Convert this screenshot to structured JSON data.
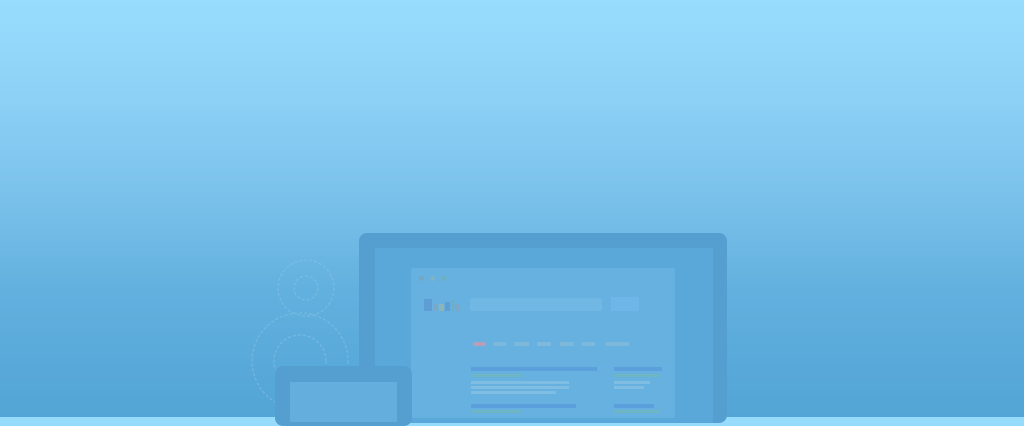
{
  "hero": {
    "bg_top": "#98dcfd",
    "bg_bottom": "#52a5d6"
  },
  "illustration": {
    "description_icon": "monitor-icon",
    "browser_mockup": {
      "window_dots": [
        "close",
        "minimize",
        "maximize"
      ],
      "logo_icon": "search-engine-logo-icon",
      "search_placeholder": "",
      "search_button_label": ""
    },
    "tablet_icon": "tablet-icon",
    "decoration_icon": "gear-icon"
  },
  "colors": {
    "accent": "#5b9fdc",
    "device_frame": "#559fd0"
  }
}
